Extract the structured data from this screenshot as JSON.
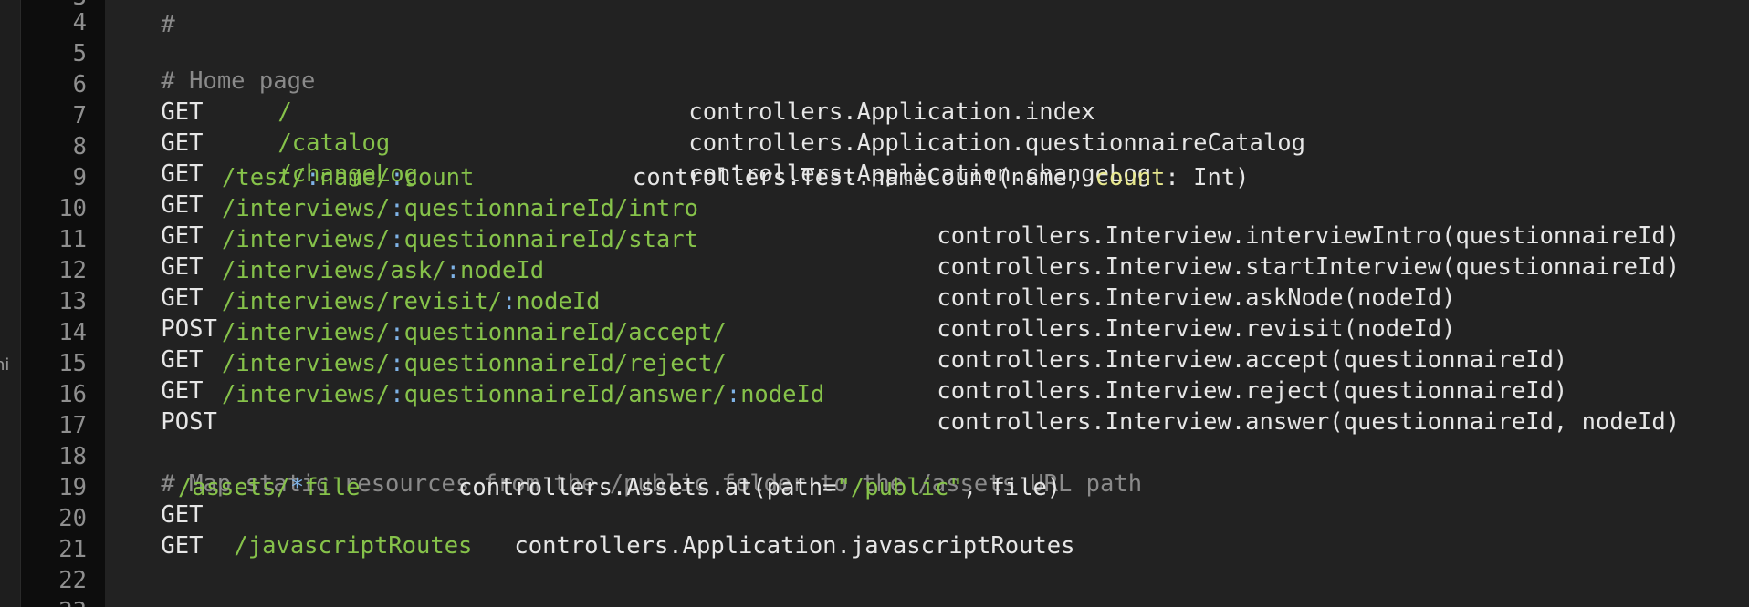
{
  "sidebar_clip_text": "hi",
  "line_numbers": [
    "3",
    "4",
    "5",
    "6",
    "7",
    "8",
    "9",
    "10",
    "11",
    "12",
    "13",
    "14",
    "15",
    "16",
    "17",
    "18",
    "19",
    "20",
    "21",
    "22",
    "23"
  ],
  "lines": {
    "l3": "#",
    "l5": "# Home page",
    "l6": {
      "verb": "GET",
      "path": "/",
      "action": "controllers.Application.index"
    },
    "l7": {
      "verb": "GET",
      "path": "/catalog",
      "action": "controllers.Application.questionnaireCatalog"
    },
    "l8": {
      "verb": "GET",
      "path": "/changeLog",
      "action": "controllers.Application.changeLog"
    },
    "l9": {
      "verb": "GET",
      "p1": "/test/",
      "c1": ":",
      "p2": "name/",
      "c2": ":",
      "p3": "count",
      "a1": "controllers.Test.nameCount(name, ",
      "a2": "count",
      "a3": ": Int)"
    },
    "l10": {
      "verb": "GET",
      "p1": "/interviews/",
      "c1": ":",
      "p2": "questionnaireId/intro",
      "action": "controllers.Interview.interviewIntro(questionnaireId)"
    },
    "l11": {
      "verb": "GET",
      "p1": "/interviews/",
      "c1": ":",
      "p2": "questionnaireId/start",
      "action": "controllers.Interview.startInterview(questionnaireId)"
    },
    "l12": {
      "verb": "GET",
      "p1": "/interviews/ask/",
      "c1": ":",
      "p2": "nodeId",
      "action": "controllers.Interview.askNode(nodeId)"
    },
    "l13": {
      "verb": "POST",
      "p1": "/interviews/revisit/",
      "c1": ":",
      "p2": "nodeId",
      "action": "controllers.Interview.revisit(nodeId)"
    },
    "l14": {
      "verb": "GET",
      "p1": "/interviews/",
      "c1": ":",
      "p2": "questionnaireId/accept/",
      "action": "controllers.Interview.accept(questionnaireId)"
    },
    "l15": {
      "verb": "GET",
      "p1": "/interviews/",
      "c1": ":",
      "p2": "questionnaireId/reject/",
      "action": "controllers.Interview.reject(questionnaireId)"
    },
    "l16": {
      "verb": "POST",
      "p1": "/interviews/",
      "c1": ":",
      "p2": "questionnaireId/answer/",
      "c2": ":",
      "p3": "nodeId",
      "action": "controllers.Interview.answer(questionnaireId, nodeId)"
    },
    "l18": "# Map static resources from the /public folder to the /assets URL path",
    "l19": {
      "verb": "GET",
      "p1": "/assets/",
      "star": "*",
      "p2": "file",
      "a1": "controllers.Assets.at(path=",
      "a2": "\"/public\"",
      "a3": ", file)"
    },
    "l20": {
      "verb": "GET",
      "path": "/javascriptRoutes",
      "action": "controllers.Application.javascriptRoutes"
    }
  },
  "colors": {
    "background": "#222222",
    "gutter": "#0d0d0d",
    "comment": "#8a8a8a",
    "path": "#86c24a",
    "param_colon": "#7fb3e6",
    "text": "#e6e6e6",
    "highlight": "#e8e88e"
  }
}
